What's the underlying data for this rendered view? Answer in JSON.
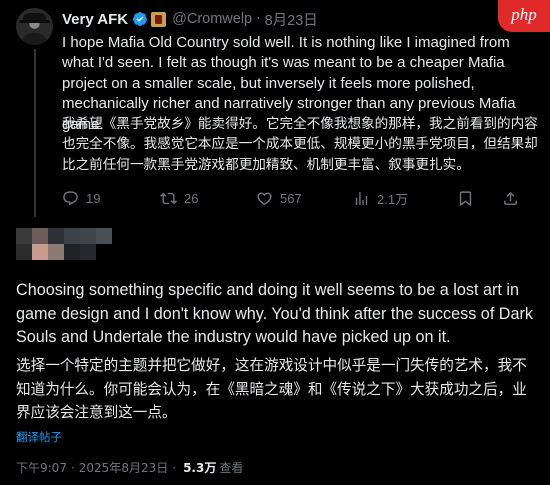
{
  "parent_tweet": {
    "author_name": "Very AFK",
    "handle": "@Cromwelp",
    "separator": "·",
    "date": "8月23日",
    "text_en": "I hope Mafia Old Country sold well. It is nothing like I imagined from what I'd seen. I felt as though it's was meant to be a cheaper Mafia project on a smaller scale, but inversely it feels more polished, mechanically richer and narratively stronger than any previous Mafia game.",
    "text_zh": "我希望《黑手党故乡》能卖得好。它完全不像我想象的那样，我之前看到的内容也完全不像。我感觉它本应是一个成本更低、规模更小的黑手党项目，但结果却比之前任何一款黑手党游戏都更加精致、机制更丰富、叙事更扎实。",
    "replies": "19",
    "retweets": "26",
    "likes": "567",
    "views": "2.1万",
    "badge_text": "php"
  },
  "reply_tweet": {
    "text_en": "Choosing something specific and doing it well seems to be a lost art in game design and I don't know why. You'd think after the success of Dark Souls and Undertale the industry would have picked up on it.",
    "text_zh": "选择一个特定的主题并把它做好，这在游戏设计中似乎是一门失传的艺术，我不知道为什么。你可能会认为，在《黑暗之魂》和《传说之下》大获成功之后，业界应该会注意到这一点。",
    "translate_label": "翻译帖子",
    "time": "下午9:07",
    "separator": "·",
    "date": "2025年8月23日",
    "views_count": "5.3万",
    "views_label": "查看"
  },
  "colors": {
    "background": "#000000",
    "text": "#e7e9ea",
    "muted": "#71767b",
    "link": "#1d9bf0",
    "verified": "#1d9bf0",
    "badge": "#e02a2a"
  },
  "icons": [
    "reply-icon",
    "retweet-icon",
    "like-icon",
    "views-icon",
    "bookmark-icon",
    "share-icon",
    "verified-icon"
  ]
}
